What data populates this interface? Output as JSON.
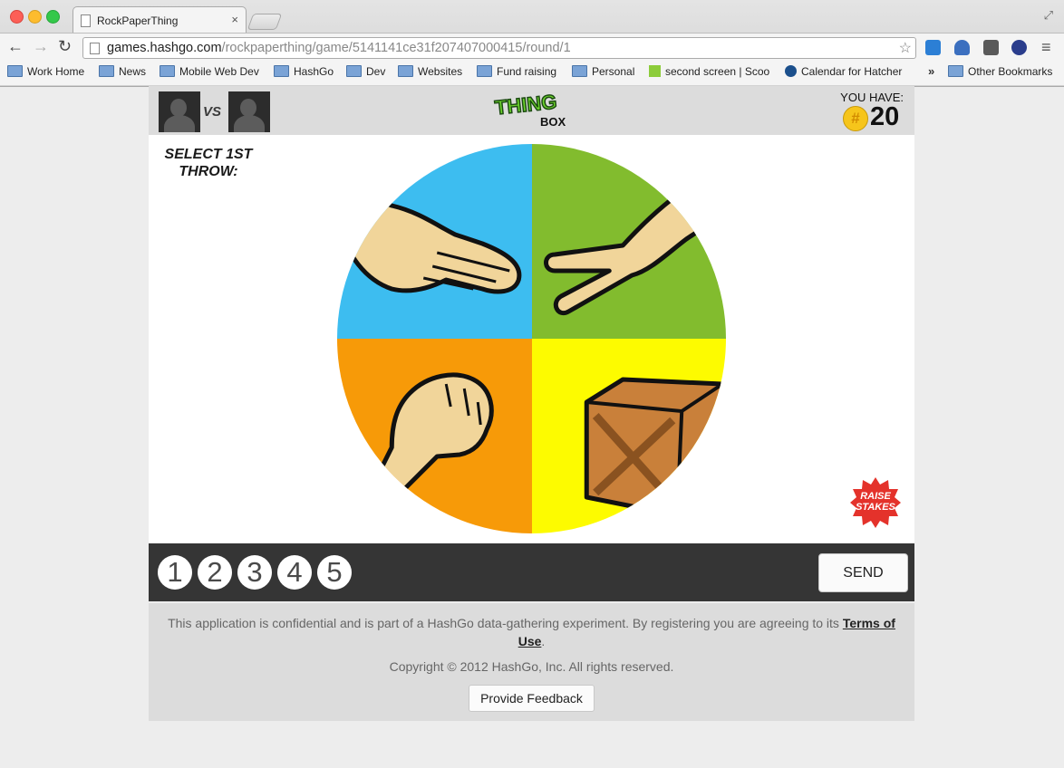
{
  "browser": {
    "tab_title": "RockPaperThing",
    "tab_close": "×",
    "url_host": "games.hashgo.com",
    "url_path": "/rockpaperthing/game/5141141ce31f207407000415/round/1",
    "bookmarks": [
      "Work Home",
      "News",
      "Mobile Web Dev",
      "HashGo",
      "Dev",
      "Websites",
      "Fund raising",
      "Personal",
      "second screen | Scoo",
      "Calendar for Hatcher"
    ],
    "bookmarks_more": "»",
    "other_bookmarks": "Other Bookmarks"
  },
  "game": {
    "vs_label": "VS",
    "logo_thing": "THING",
    "logo_box": "BOX",
    "you_have_label": "YOU HAVE:",
    "coin_symbol": "#",
    "balance": "20",
    "select_throw": "SELECT 1ST THROW:",
    "throw_options": [
      "paper",
      "scissors",
      "rock",
      "box"
    ],
    "raise_stakes_line1": "RAISE",
    "raise_stakes_line2": "STAKES",
    "rounds": [
      "1",
      "2",
      "3",
      "4",
      "5"
    ],
    "send_label": "SEND"
  },
  "footer": {
    "legal_text": "This application is confidential and is part of a HashGo data-gathering experiment. By registering you are agreeing to its ",
    "terms_link": "Terms of Use",
    "legal_end": ".",
    "copyright": "Copyright © 2012 HashGo, Inc. All rights reserved.",
    "feedback_label": "Provide Feedback"
  },
  "colors": {
    "paper": "#3dbdf0",
    "scissors": "#82bc2e",
    "rock": "#f79a08",
    "box": "#fdfb00",
    "control_bar": "#353535"
  }
}
